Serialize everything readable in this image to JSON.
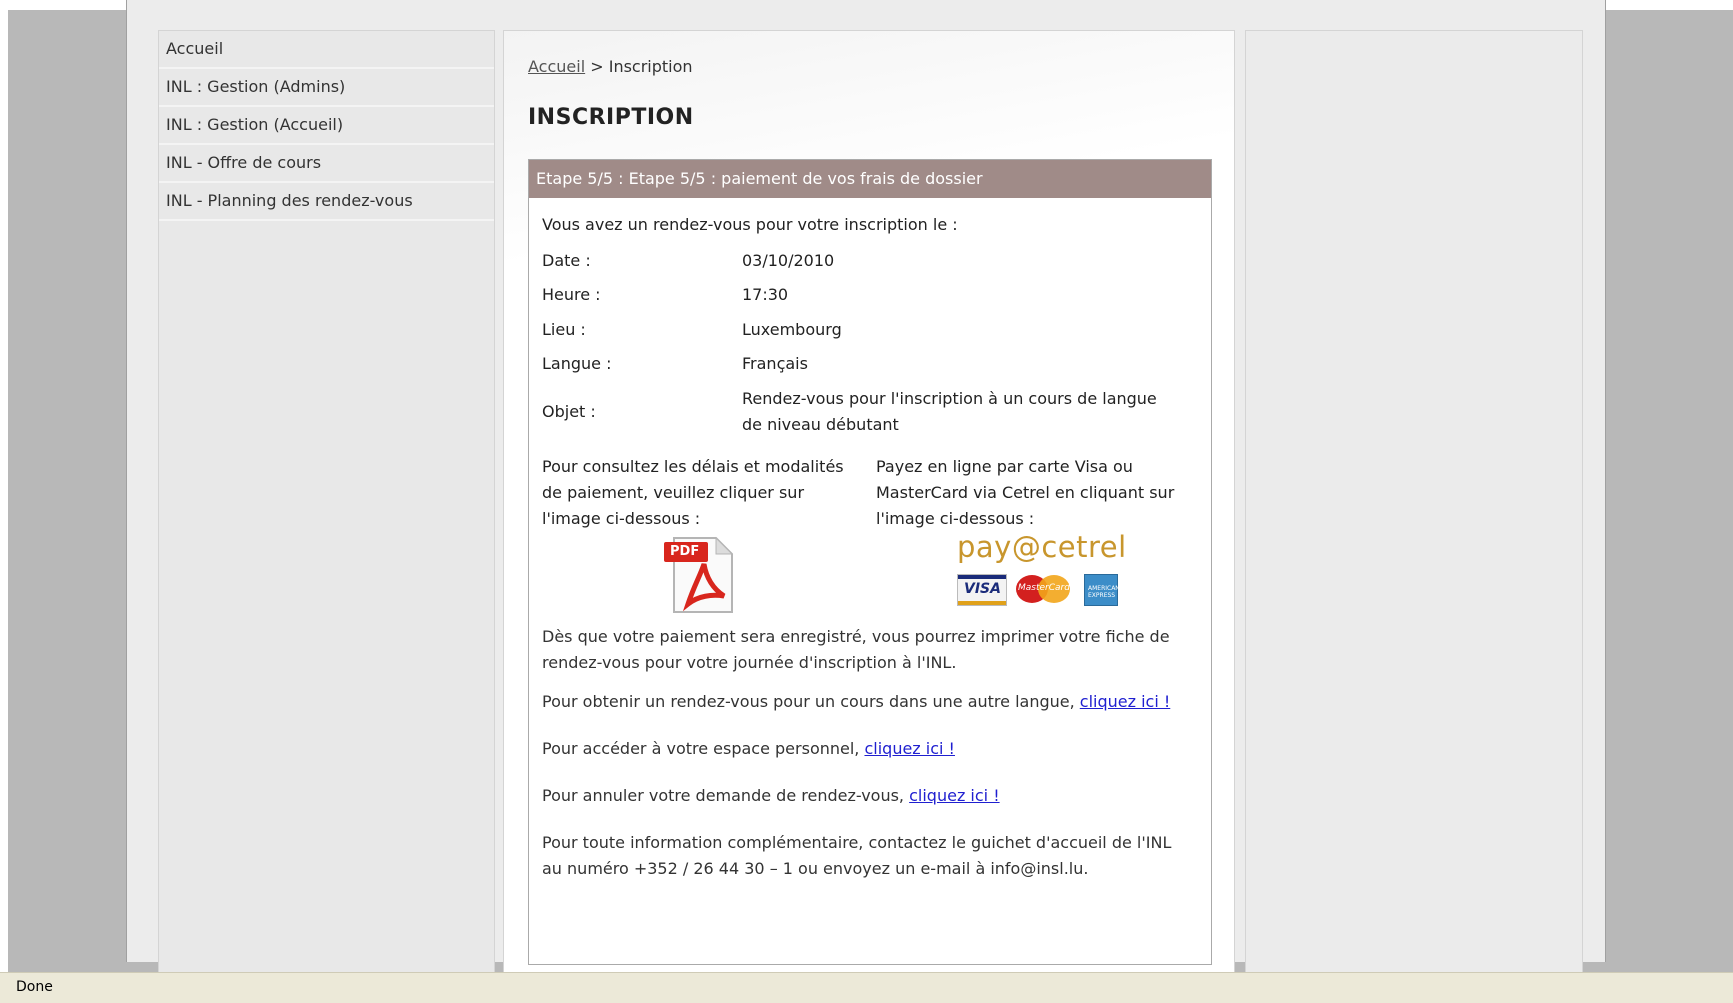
{
  "sidebar": {
    "items": [
      {
        "label": "Accueil"
      },
      {
        "label": "INL : Gestion (Admins)"
      },
      {
        "label": "INL : Gestion (Accueil)"
      },
      {
        "label": "INL - Offre de cours"
      },
      {
        "label": "INL - Planning des rendez-vous"
      }
    ]
  },
  "breadcrumb": {
    "home": "Accueil",
    "separator": " > ",
    "current": "Inscription"
  },
  "page_title": "INSCRIPTION",
  "step": {
    "header": "Etape 5/5 : Etape 5/5 : paiement de vos frais de dossier",
    "intro": "Vous avez un rendez-vous pour votre inscription le :",
    "details": [
      {
        "label": "Date :",
        "value": "03/10/2010"
      },
      {
        "label": "Heure :",
        "value": "17:30"
      },
      {
        "label": "Lieu :",
        "value": "Luxembourg"
      },
      {
        "label": "Langue :",
        "value": "Français"
      },
      {
        "label": "Objet :",
        "value": "Rendez-vous pour l'inscription à un cours de langue de niveau débutant"
      }
    ],
    "pdf_text": "Pour consultez les délais et modalités de paiement, veuillez cliquer sur l'image ci-dessous :",
    "pay_text": "Payez en ligne par carte Visa ou MasterCard via Cetrel en cliquant sur l'image ci-dessous :",
    "pdf_badge": "PDF",
    "pay_logo": "pay@cetrel",
    "cards": {
      "visa": "VISA",
      "mastercard": "MasterCard",
      "amex": "AMERICAN EXPRESS"
    }
  },
  "paragraphs": {
    "after_payment": "Dès que votre paiement sera enregistré, vous pourrez imprimer votre fiche de rendez-vous pour votre journée d'inscription à l'INL.",
    "other_language": "Pour obtenir un rendez-vous pour un cours dans une autre langue, ",
    "personal_space": "Pour accéder à votre espace personnel, ",
    "cancel": "Pour annuler votre demande de rendez-vous, ",
    "link_label": "cliquez ici !",
    "contact": "Pour toute information complémentaire, contactez le guichet d'accueil de l'INL au numéro +352 / 26 44 30 – 1 ou envoyez un e-mail à info@insl.lu."
  },
  "status_bar": {
    "text": "Done"
  },
  "colors": {
    "step_header": "#a08b88",
    "link": "#1f1fd0",
    "pay_logo": "#c8962d"
  }
}
